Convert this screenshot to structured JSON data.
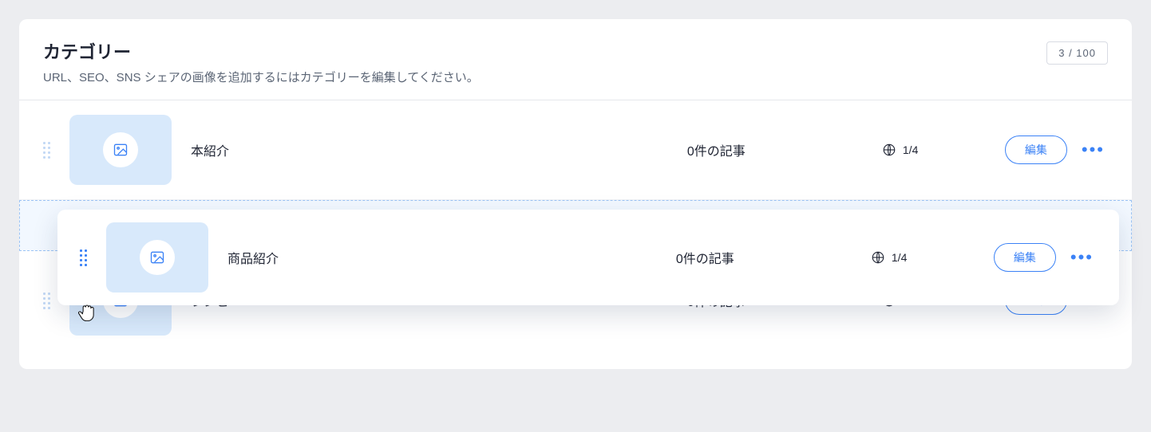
{
  "header": {
    "title": "カテゴリー",
    "subtitle": "URL、SEO、SNS シェアの画像を追加するにはカテゴリーを編集してください。",
    "counter": "3 / 100"
  },
  "actions": {
    "edit_label": "編集"
  },
  "rows": [
    {
      "name": "本紹介",
      "articles": "0件の記事",
      "lang": "1/4"
    },
    {
      "name": "商品紹介",
      "articles": "0件の記事",
      "lang": "1/4"
    },
    {
      "name": "レシピ",
      "articles": "0件の記事",
      "lang": "1/4"
    }
  ]
}
